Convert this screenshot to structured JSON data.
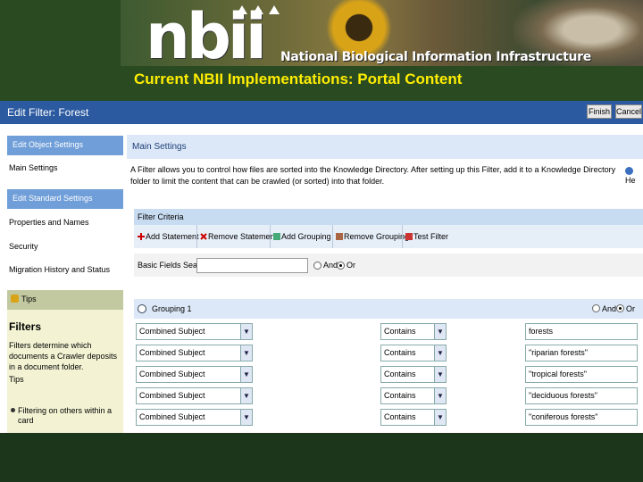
{
  "banner": {
    "logo_word": "nbii",
    "logo_subtitle": "National Biological Information Infrastructure",
    "slide_title": "Current NBII Implementations: Portal Content"
  },
  "window": {
    "title": "Edit Filter: Forest",
    "finish_label": "Finish",
    "cancel_label": "Cancel"
  },
  "sidebar": {
    "object_settings_header": "Edit Object Settings",
    "main_settings_link": "Main Settings",
    "standard_settings_header": "Edit Standard Settings",
    "items": [
      "Properties and Names",
      "Security",
      "Migration History and Status"
    ],
    "tips_header": "Tips",
    "filters_heading": "Filters",
    "filters_text": "Filters determine which documents a Crawler deposits in a document folder.",
    "tips_sub": "Tips",
    "tip_bullet": "Filtering on others within a card"
  },
  "main": {
    "header": "Main Settings",
    "description": "A Filter allows you to control how files are sorted into the Knowledge Directory. After setting up this Filter, add it to a Knowledge Directory folder to limit the content that can be crawled (or sorted) into that folder.",
    "help_label": "He"
  },
  "criteria": {
    "header": "Filter Criteria",
    "tools": [
      "Add Statement",
      "Remove Statement",
      "Add Grouping",
      "Remove Grouping",
      "Test Filter"
    ],
    "basic_label": "Basic Fields Search:",
    "and_label": "And",
    "or_label": "Or",
    "grouping_label": "Grouping 1",
    "grouping_and": "And",
    "grouping_or": "Or",
    "rows": [
      {
        "field": "Combined Subject",
        "op": "Contains",
        "value": "forests"
      },
      {
        "field": "Combined Subject",
        "op": "Contains",
        "value": "\"riparian forests\""
      },
      {
        "field": "Combined Subject",
        "op": "Contains",
        "value": "\"tropical forests\""
      },
      {
        "field": "Combined Subject",
        "op": "Contains",
        "value": "\"deciduous forests\""
      },
      {
        "field": "Combined Subject",
        "op": "Contains",
        "value": "\"coniferous forests\""
      }
    ]
  },
  "colors": {
    "titlebar": "#2b5aa0",
    "section_header": "#6f9ed8",
    "slide_title": "#ffee00",
    "background": "#1f3d1f"
  }
}
